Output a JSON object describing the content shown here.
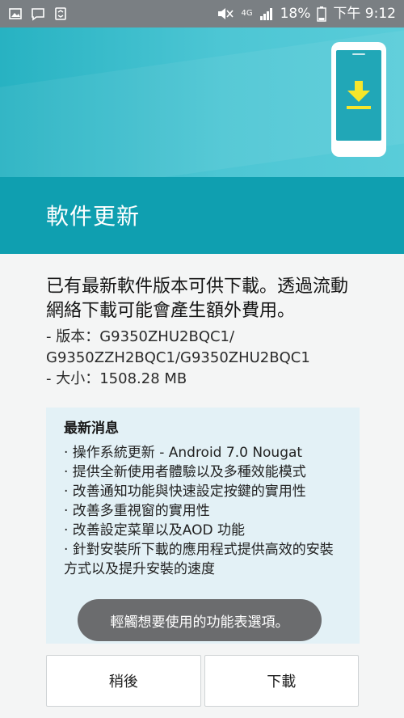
{
  "status_bar": {
    "network_label": "4G",
    "battery_text": "18%",
    "time_text": "下午 9:12",
    "icons": [
      "gallery-icon",
      "message-icon",
      "recycle-icon",
      "mute-icon",
      "network-arrows-icon",
      "signal-icon",
      "battery-icon"
    ]
  },
  "header": {
    "title": "軟件更新",
    "illustration": "phone-download-icon",
    "colors": {
      "top": "#4dc6d4",
      "bottom": "#0f9fb0",
      "icon_yellow": "#f6e62b"
    }
  },
  "body": {
    "intro": "已有最新軟件版本可供下載。透過流動網絡下載可能會產生額外費用。",
    "version_line1": "- 版本：G9350ZHU2BQC1/",
    "version_line2": "G9350ZZH2BQC1/G9350ZHU2BQC1",
    "size_line": "- 大小：1508.28 MB"
  },
  "news": {
    "title": "最新消息",
    "items": [
      "· 操作系統更新 - Android 7.0 Nougat",
      "· 提供全新使用者體驗以及多種效能模式",
      "· 改善通知功能與快速設定按鍵的實用性",
      "· 改善多重視窗的實用性",
      "· 改善設定菜單以及AOD 功能",
      "· 針對安裝所下載的應用程式提供高效的安裝方式以及提升安裝的速度"
    ]
  },
  "toast": {
    "text": "輕觸想要使用的功能表選項。"
  },
  "buttons": {
    "later": "稍後",
    "download": "下載"
  }
}
